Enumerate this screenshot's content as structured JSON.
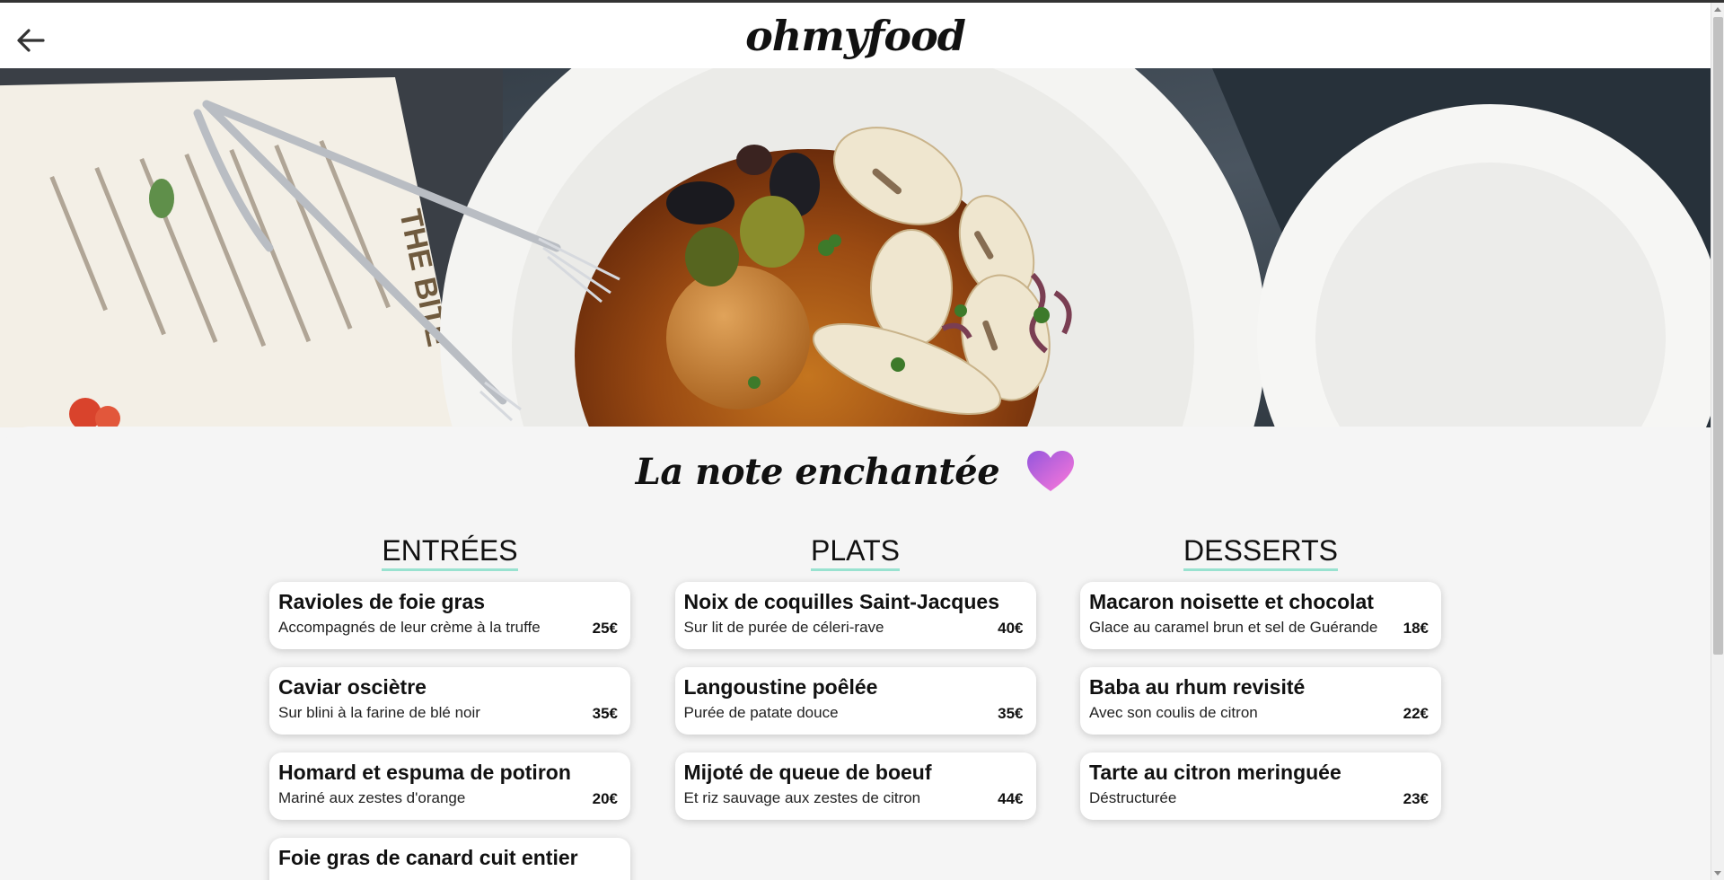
{
  "header": {
    "logo": "ohmyfood",
    "back_icon": "arrow-left-icon"
  },
  "hero": {
    "image": "food-plate-photo"
  },
  "restaurant": {
    "name": "La note enchantée",
    "like_icon": "heart-icon",
    "heart_color": "#d15ee0"
  },
  "accent_color": "#99e2d0",
  "menu": {
    "columns": [
      {
        "title": "ENTRÉES",
        "items": [
          {
            "name": "Ravioles de foie gras",
            "desc": "Accompagnés de leur crème à la truffe",
            "price": "25€"
          },
          {
            "name": "Caviar osciètre",
            "desc": "Sur blini à la farine de blé noir",
            "price": "35€"
          },
          {
            "name": "Homard et espuma de potiron",
            "desc": "Mariné aux zestes d'orange",
            "price": "20€"
          },
          {
            "name": "Foie gras de canard cuit entier",
            "desc": "",
            "price": ""
          }
        ]
      },
      {
        "title": "PLATS",
        "items": [
          {
            "name": "Noix de coquilles Saint-Jacques",
            "desc": "Sur lit de purée de céleri-rave",
            "price": "40€"
          },
          {
            "name": "Langoustine poêlée",
            "desc": "Purée de patate douce",
            "price": "35€"
          },
          {
            "name": "Mijoté de queue de boeuf",
            "desc": "Et riz sauvage aux zestes de citron",
            "price": "44€"
          }
        ]
      },
      {
        "title": "DESSERTS",
        "items": [
          {
            "name": "Macaron noisette et chocolat",
            "desc": "Glace au caramel brun et sel de Guérande",
            "price": "18€"
          },
          {
            "name": "Baba au rhum revisité",
            "desc": "Avec son coulis de citron",
            "price": "22€"
          },
          {
            "name": "Tarte au citron meringuée",
            "desc": "Déstructurée",
            "price": "23€"
          }
        ]
      }
    ]
  }
}
